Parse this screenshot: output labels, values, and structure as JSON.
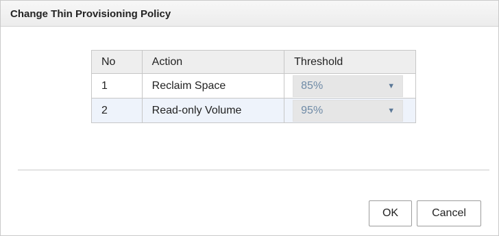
{
  "dialog": {
    "title": "Change Thin Provisioning Policy"
  },
  "table": {
    "headers": {
      "no": "No",
      "action": "Action",
      "threshold": "Threshold"
    },
    "rows": [
      {
        "no": "1",
        "action": "Reclaim Space",
        "threshold": "85%"
      },
      {
        "no": "2",
        "action": "Read-only Volume",
        "threshold": "95%"
      }
    ],
    "dropdown_icon": "▼"
  },
  "buttons": {
    "ok_label": "OK",
    "cancel_label": "Cancel"
  },
  "colors": {
    "title_bar": "#eeeeee",
    "header_row": "#eeeeee",
    "alt_row": "#eef3fb",
    "select_bg": "#e6e6e6",
    "select_text": "#6e8aa6"
  }
}
